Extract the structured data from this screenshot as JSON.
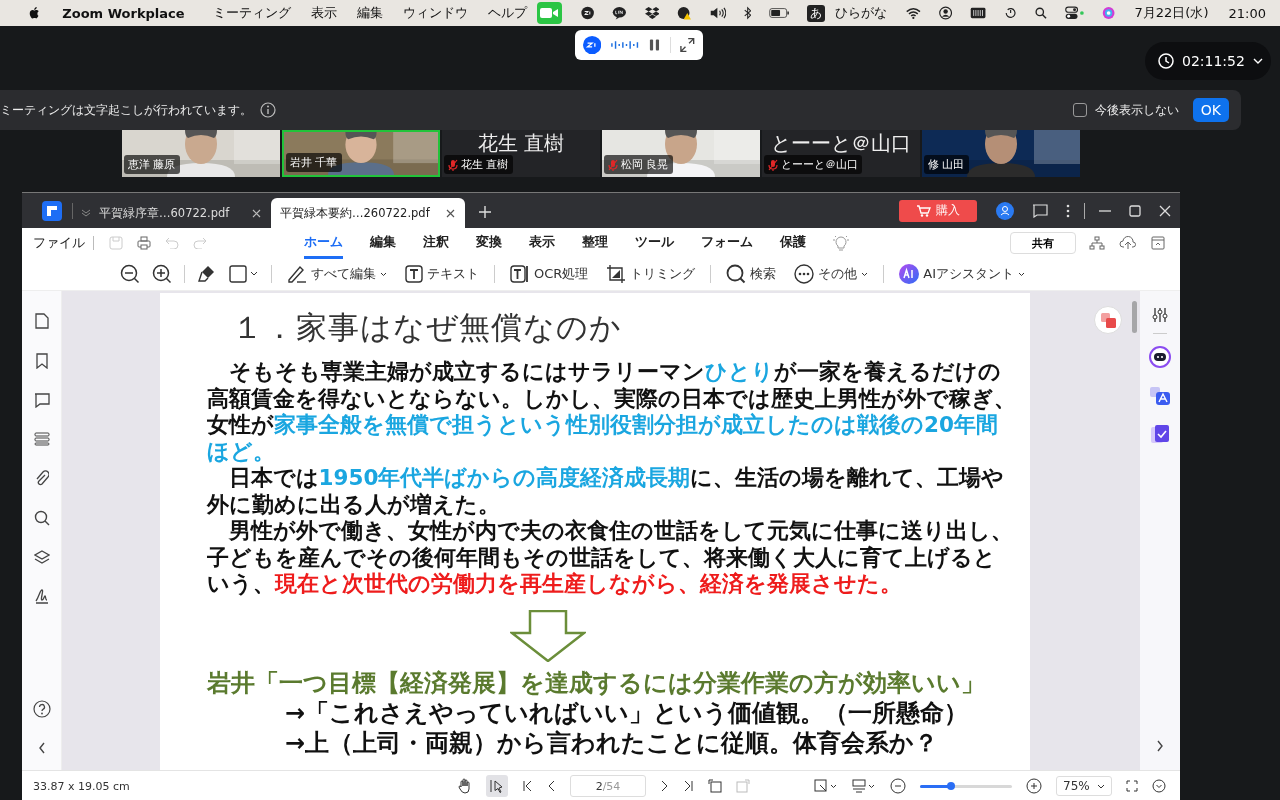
{
  "menubar": {
    "app": "Zoom Workplace",
    "menus": [
      "ミーティング",
      "表示",
      "編集",
      "ウィンドウ",
      "ヘルプ"
    ],
    "input_mode": "あ",
    "input_label": "ひらがな",
    "date": "7月22日(水)",
    "time": "21:00"
  },
  "zoom": {
    "timer": "02:11:52",
    "banner": {
      "text": "ミーティングは文字起こしが行われています。",
      "checkbox_label": "今後表示しない",
      "checked": false,
      "ok": "OK"
    },
    "tiles": [
      {
        "kind": "video",
        "name": "恵洋 藤原",
        "muted": false,
        "speaking": false
      },
      {
        "kind": "video",
        "name": "岩井 千華",
        "muted": false,
        "speaking": true
      },
      {
        "kind": "name",
        "display": "花生 直樹",
        "name": "花生 直樹",
        "muted": true,
        "speaking": false
      },
      {
        "kind": "video",
        "name": "松岡 良晃",
        "muted": true,
        "speaking": false
      },
      {
        "kind": "name",
        "display": "とーーと＠山口",
        "name": "とーーと＠山口",
        "muted": true,
        "speaking": false
      },
      {
        "kind": "video",
        "name": "修 山田",
        "muted": false,
        "speaking": false
      }
    ]
  },
  "pdf": {
    "tabs": [
      {
        "label": "平賀緑序章…60722.pdf",
        "selected": false
      },
      {
        "label": "平賀緑本要約…260722.pdf",
        "selected": true
      }
    ],
    "buy": "購入",
    "file_menu": "ファイル",
    "ribbon_tabs": [
      {
        "label": "ホーム",
        "selected": true
      },
      {
        "label": "編集",
        "selected": false
      },
      {
        "label": "注釈",
        "selected": false
      },
      {
        "label": "変換",
        "selected": false
      },
      {
        "label": "表示",
        "selected": false
      },
      {
        "label": "整理",
        "selected": false
      },
      {
        "label": "ツール",
        "selected": false
      },
      {
        "label": "フォーム",
        "selected": false
      },
      {
        "label": "保護",
        "selected": false
      }
    ],
    "share": "共有",
    "tools": [
      {
        "kind": "edit",
        "label": "すべて編集",
        "menu": true
      },
      {
        "kind": "text",
        "label": "テキスト",
        "menu": false
      },
      {
        "kind": "ocr",
        "label": "OCR処理",
        "menu": false
      },
      {
        "kind": "crop",
        "label": "トリミング",
        "menu": false
      },
      {
        "kind": "search",
        "label": "検索",
        "menu": false
      },
      {
        "kind": "more",
        "label": "その他",
        "menu": true
      },
      {
        "kind": "ai",
        "label": "AIアシスタント",
        "menu": true
      }
    ],
    "page": {
      "heading": "１．家事はなぜ無償なのか",
      "paragraphs": [
        {
          "lines": [
            [
              {
                "text": "そもそも専業主婦が成立するにはサラリーマン",
                "color": "#111111"
              },
              {
                "text": "ひとり",
                "color": "#1aa6e0"
              },
              {
                "text": "が一家を養えるだけの",
                "color": "#111111"
              }
            ],
            [
              {
                "text": "高額賃金を得ないとならない。しかし、実際の日本では歴史上男性が外で稼ぎ、",
                "color": "#111111"
              }
            ],
            [
              {
                "text": "女性が",
                "color": "#111111"
              },
              {
                "text": "家事全般を無償で担うという性別役割分担が成立したのは戦後の20年間",
                "color": "#1aa6e0"
              }
            ],
            [
              {
                "text": "ほど。",
                "color": "#1aa6e0"
              }
            ]
          ]
        },
        {
          "lines": [
            [
              {
                "text": "日本では",
                "color": "#111111"
              },
              {
                "text": "1950年代半ばからの高度経済成長期",
                "color": "#1aa6e0"
              },
              {
                "text": "に、生活の場を離れて、工場や",
                "color": "#111111"
              }
            ],
            [
              {
                "text": "外に勤めに出る人が増えた。",
                "color": "#111111"
              }
            ]
          ]
        },
        {
          "lines": [
            [
              {
                "text": "男性が外で働き、女性が内で夫の衣食住の世話をして元気に仕事に送り出し、",
                "color": "#111111"
              }
            ],
            [
              {
                "text": "子どもを産んでその後何年間もその世話をして、将来働く大人に育て上げると",
                "color": "#111111"
              }
            ],
            [
              {
                "text": "いう、",
                "color": "#111111"
              },
              {
                "text": "現在と次世代の労働力を再生産しながら、経済を発展させた。",
                "color": "#ee1c1c"
              }
            ]
          ]
        }
      ],
      "conclusion": "岩井「一つ目標【経済発展】を達成するには分業作業の方が効率いい」",
      "points": [
        "→「これさえやっていればいい」という価値観。（一所懸命）",
        "→上（上司・両親）から言われたことに従順。体育会系か？"
      ]
    },
    "status": {
      "size": "33.87 x 19.05 cm",
      "page": "2",
      "pages": "/54",
      "zoom_slider": {
        "level": 0.34
      },
      "zoom": "75%"
    }
  }
}
